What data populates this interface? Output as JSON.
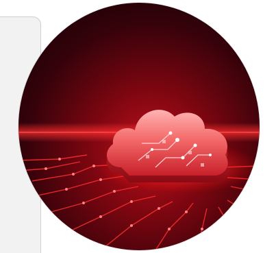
{
  "image": {
    "icon": "cloud-icon",
    "colors": {
      "glow": "#ff2a2a",
      "deep": "#2a0004",
      "cloud_light": "#ff9a9a",
      "cloud_mid": "#f04a4a"
    }
  }
}
